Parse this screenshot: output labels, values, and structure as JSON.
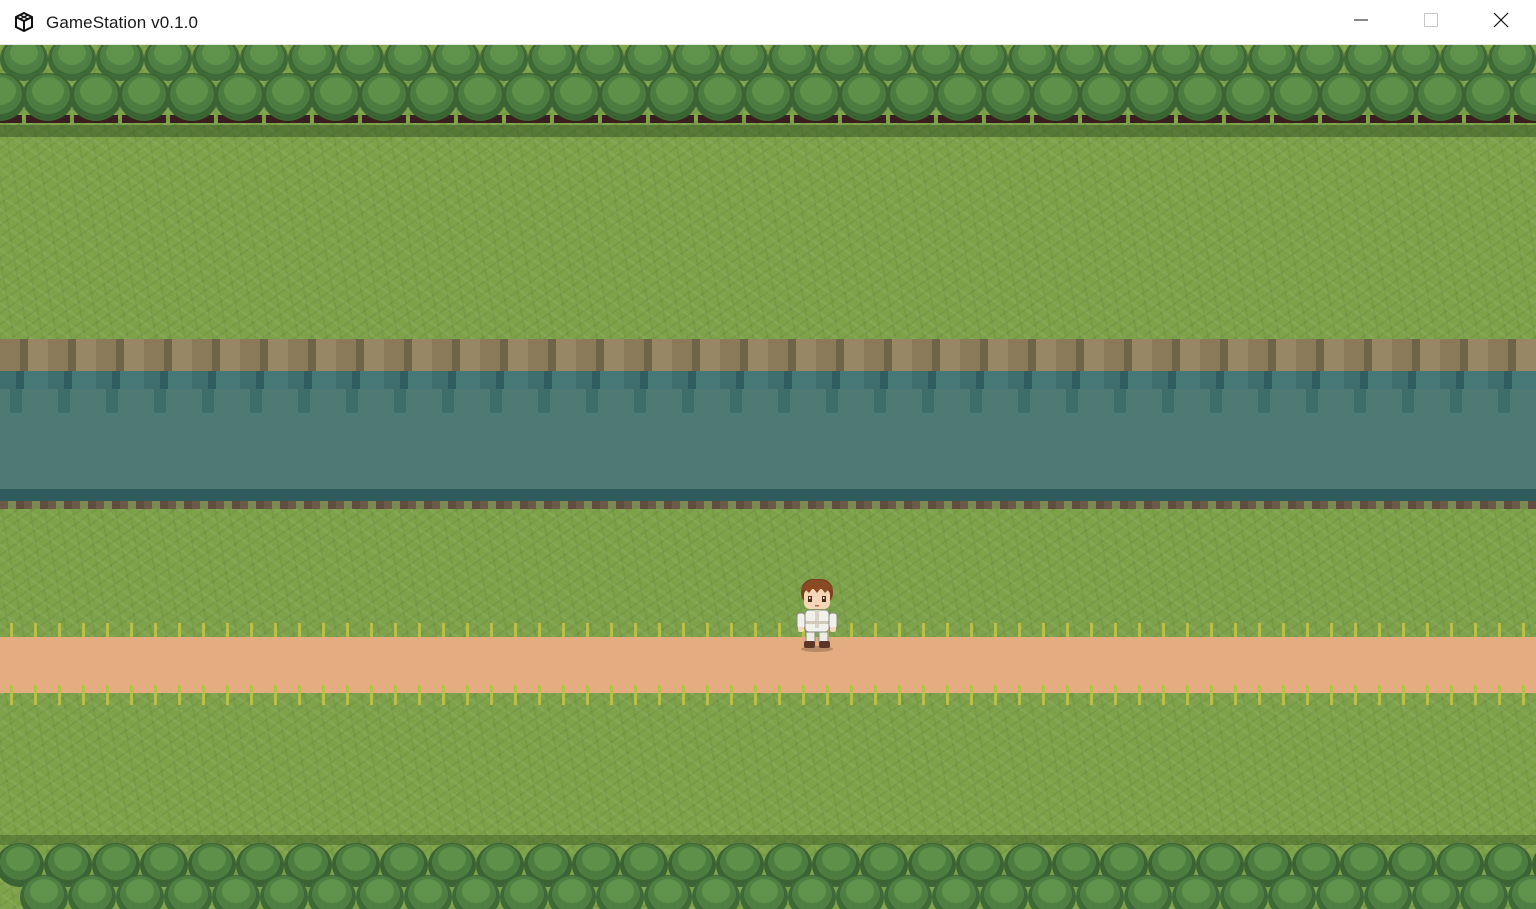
{
  "window": {
    "title": "GameStation v0.1.0",
    "app_icon": "cube-icon",
    "controls": [
      "minimize-icon",
      "maximize-icon",
      "close-icon"
    ]
  },
  "scene": {
    "layers": [
      "trees",
      "grass",
      "river",
      "grass",
      "dirt-path",
      "grass",
      "trees"
    ],
    "player": {
      "sprite": "hero-character",
      "hair": "#7b3f1f",
      "outfit": "#f2f0ea",
      "facing": "down"
    },
    "colors": {
      "grass": "#7da24a",
      "water": "#4f7a73",
      "path": "#e3ad7f",
      "tree": "#5f8f45"
    }
  }
}
